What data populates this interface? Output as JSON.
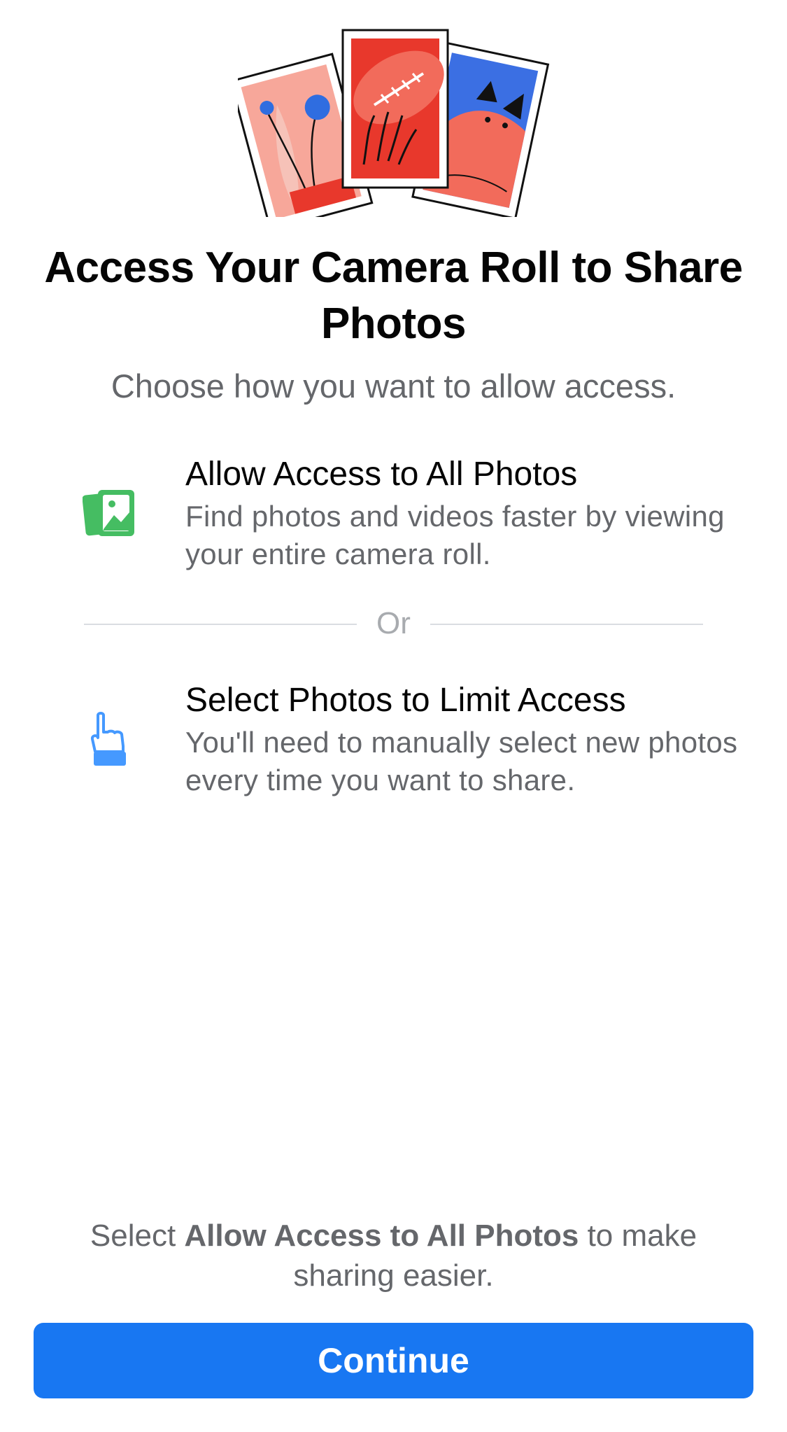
{
  "header": {
    "title": "Access Your Camera Roll to Share Photos",
    "subtitle": "Choose how you want to allow access."
  },
  "options": [
    {
      "icon": "photos-icon",
      "title": "Allow Access to All Photos",
      "description": "Find photos and videos faster by viewing your entire camera roll."
    },
    {
      "icon": "pointing-hand-icon",
      "title": "Select Photos to Limit Access",
      "description": "You'll need to manually select new photos every time you want to share."
    }
  ],
  "divider": {
    "label": "Or"
  },
  "footer": {
    "note_prefix": "Select ",
    "note_bold": "Allow Access to All Photos",
    "note_suffix": " to make sharing easier.",
    "continue_label": "Continue"
  },
  "colors": {
    "primary": "#1877f2",
    "secondary_text": "#65676b",
    "icon_green": "#45bd62",
    "icon_blue": "#4599ff"
  }
}
